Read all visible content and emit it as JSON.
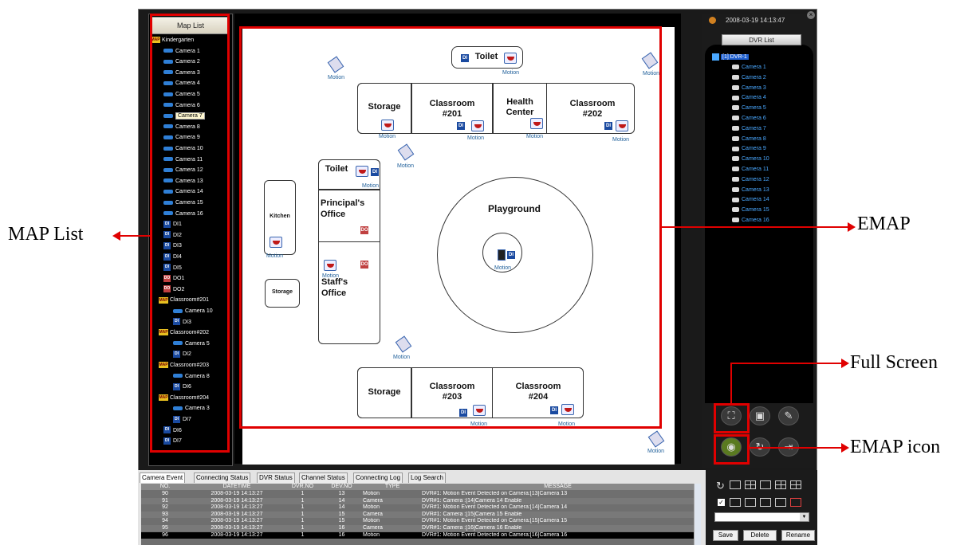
{
  "annotations": {
    "map_list": "MAP List",
    "emap": "EMAP",
    "full_screen": "Full Screen",
    "emap_icon": "EMAP icon"
  },
  "map_list": {
    "title": "Map List",
    "items": [
      {
        "label": "Kindergarten",
        "kind": "map"
      },
      {
        "label": "Camera 1",
        "kind": "cam"
      },
      {
        "label": "Camera 2",
        "kind": "cam"
      },
      {
        "label": "Camera 3",
        "kind": "cam"
      },
      {
        "label": "Camera 4",
        "kind": "cam"
      },
      {
        "label": "Camera 5",
        "kind": "cam"
      },
      {
        "label": "Camera 6",
        "kind": "cam"
      },
      {
        "label": "Camera 7",
        "kind": "cam",
        "selected": true
      },
      {
        "label": "Camera 8",
        "kind": "cam"
      },
      {
        "label": "Camera 9",
        "kind": "cam"
      },
      {
        "label": "Camera 10",
        "kind": "cam"
      },
      {
        "label": "Camera 11",
        "kind": "cam"
      },
      {
        "label": "Camera 12",
        "kind": "cam"
      },
      {
        "label": "Camera 13",
        "kind": "cam"
      },
      {
        "label": "Camera 14",
        "kind": "cam"
      },
      {
        "label": "Camera 15",
        "kind": "cam"
      },
      {
        "label": "Camera 16",
        "kind": "cam"
      },
      {
        "label": "DI1",
        "kind": "di"
      },
      {
        "label": "DI2",
        "kind": "di"
      },
      {
        "label": "DI3",
        "kind": "di"
      },
      {
        "label": "DI4",
        "kind": "di"
      },
      {
        "label": "DI5",
        "kind": "di"
      },
      {
        "label": "DO1",
        "kind": "do"
      },
      {
        "label": "DO2",
        "kind": "do"
      },
      {
        "label": "Classroom#201",
        "kind": "map"
      },
      {
        "label": "Camera 10",
        "kind": "cam",
        "sub": true
      },
      {
        "label": "DI3",
        "kind": "di",
        "sub": true
      },
      {
        "label": "Classroom#202",
        "kind": "map"
      },
      {
        "label": "Camera 5",
        "kind": "cam",
        "sub": true
      },
      {
        "label": "DI2",
        "kind": "di",
        "sub": true
      },
      {
        "label": "Classroom#203",
        "kind": "map"
      },
      {
        "label": "Camera 8",
        "kind": "cam",
        "sub": true
      },
      {
        "label": "DI6",
        "kind": "di",
        "sub": true
      },
      {
        "label": "Classroom#204",
        "kind": "map"
      },
      {
        "label": "Camera 3",
        "kind": "cam",
        "sub": true
      },
      {
        "label": "DI7",
        "kind": "di",
        "sub": true
      },
      {
        "label": "DI6",
        "kind": "di"
      },
      {
        "label": "DI7",
        "kind": "di"
      }
    ],
    "map_badge": "MAP",
    "di_badge": "DI",
    "do_badge": "DO"
  },
  "emap": {
    "rooms": {
      "toilet_top": "Toilet",
      "storage_top": "Storage",
      "classroom201": "Classroom\n#201",
      "health": "Health\nCenter",
      "classroom202": "Classroom\n#202",
      "toilet_mid": "Toilet",
      "kitchen": "Kitchen",
      "principal": "Principal's\nOffice",
      "staff": "Staff's\nOffice",
      "storage_left": "Storage",
      "playground": "Playground",
      "storage_bottom": "Storage",
      "classroom203": "Classroom\n#203",
      "classroom204": "Classroom\n#204"
    },
    "motion_label": "Motion",
    "di_label": "DI",
    "do_label": "DO"
  },
  "header": {
    "datetime": "2008-03-19 14:13:47",
    "dvr_list_title": "DVR List"
  },
  "dvr_list": {
    "root": "[1] DVR-1",
    "cameras": [
      "Camera 1",
      "Camera 2",
      "Camera 3",
      "Camera 4",
      "Camera 5",
      "Camera 6",
      "Camera 7",
      "Camera 8",
      "Camera 9",
      "Camera 10",
      "Camera 11",
      "Camera 12",
      "Camera 13",
      "Camera 14",
      "Camera 15",
      "Camera 16"
    ]
  },
  "tabs": [
    "Camera Event",
    "Connecting Status",
    "DVR Status",
    "Channel Status",
    "Connecting Log",
    "Log Search"
  ],
  "log": {
    "columns": [
      "NO.",
      "DATETIME",
      "DVR.NO",
      "DEV.NO",
      "TYPE",
      "MESSAGE"
    ],
    "rows": [
      [
        "90",
        "2008-03-19 14:13:27",
        "1",
        "13",
        "Motion",
        "DVR#1: Motion Event Detected on Camera:[13]Camera 13"
      ],
      [
        "91",
        "2008-03-19 14:13:27",
        "1",
        "14",
        "Camera",
        "DVR#1: Camera :[14]Camera 14 Enable"
      ],
      [
        "92",
        "2008-03-19 14:13:27",
        "1",
        "14",
        "Motion",
        "DVR#1: Motion Event Detected on Camera:[14]Camera 14"
      ],
      [
        "93",
        "2008-03-19 14:13:27",
        "1",
        "15",
        "Camera",
        "DVR#1: Camera :[15]Camera 15 Enable"
      ],
      [
        "94",
        "2008-03-19 14:13:27",
        "1",
        "15",
        "Motion",
        "DVR#1: Motion Event Detected on Camera:[15]Camera 15"
      ],
      [
        "95",
        "2008-03-19 14:13:27",
        "1",
        "16",
        "Camera",
        "DVR#1: Camera :[16]Camera 16 Enable"
      ],
      [
        "96",
        "2008-03-19 14:13:27",
        "1",
        "16",
        "Motion",
        "DVR#1: Motion Event Detected on Camera:[16]Camera 16"
      ]
    ]
  },
  "buttons": {
    "save": "Save",
    "delete": "Delete",
    "rename": "Rename"
  },
  "icons": [
    "full-screen-icon",
    "snapshot-icon",
    "settings-icon",
    "emap-icon",
    "refresh-icon",
    "exit-icon"
  ],
  "colors": {
    "annotation": "#e00000",
    "tree_text": "#ffffff",
    "dvr_text": "#4aa8ff"
  }
}
